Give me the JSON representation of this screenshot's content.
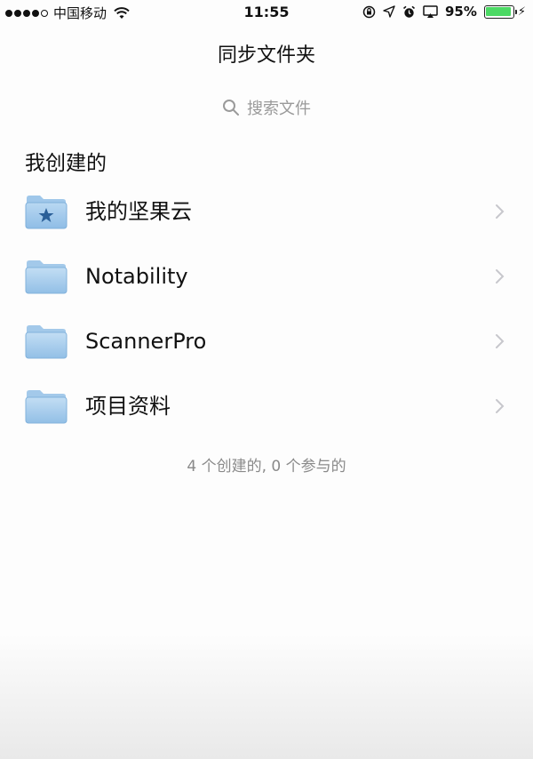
{
  "status_bar": {
    "carrier": "中国移动",
    "time": "11:55",
    "battery_percent": "95%",
    "battery_level": 0.95,
    "battery_color": "#4cd964"
  },
  "nav": {
    "title": "同步文件夹"
  },
  "search": {
    "placeholder": "搜索文件",
    "icon": "search-icon"
  },
  "section": {
    "title": "我创建的"
  },
  "folders": [
    {
      "label": "我的坚果云",
      "icon": "starred-folder-icon"
    },
    {
      "label": "Notability",
      "icon": "folder-icon"
    },
    {
      "label": "ScannerPro",
      "icon": "folder-icon"
    },
    {
      "label": "项目资料",
      "icon": "folder-icon"
    }
  ],
  "summary": "4 个创建的, 0 个参与的"
}
